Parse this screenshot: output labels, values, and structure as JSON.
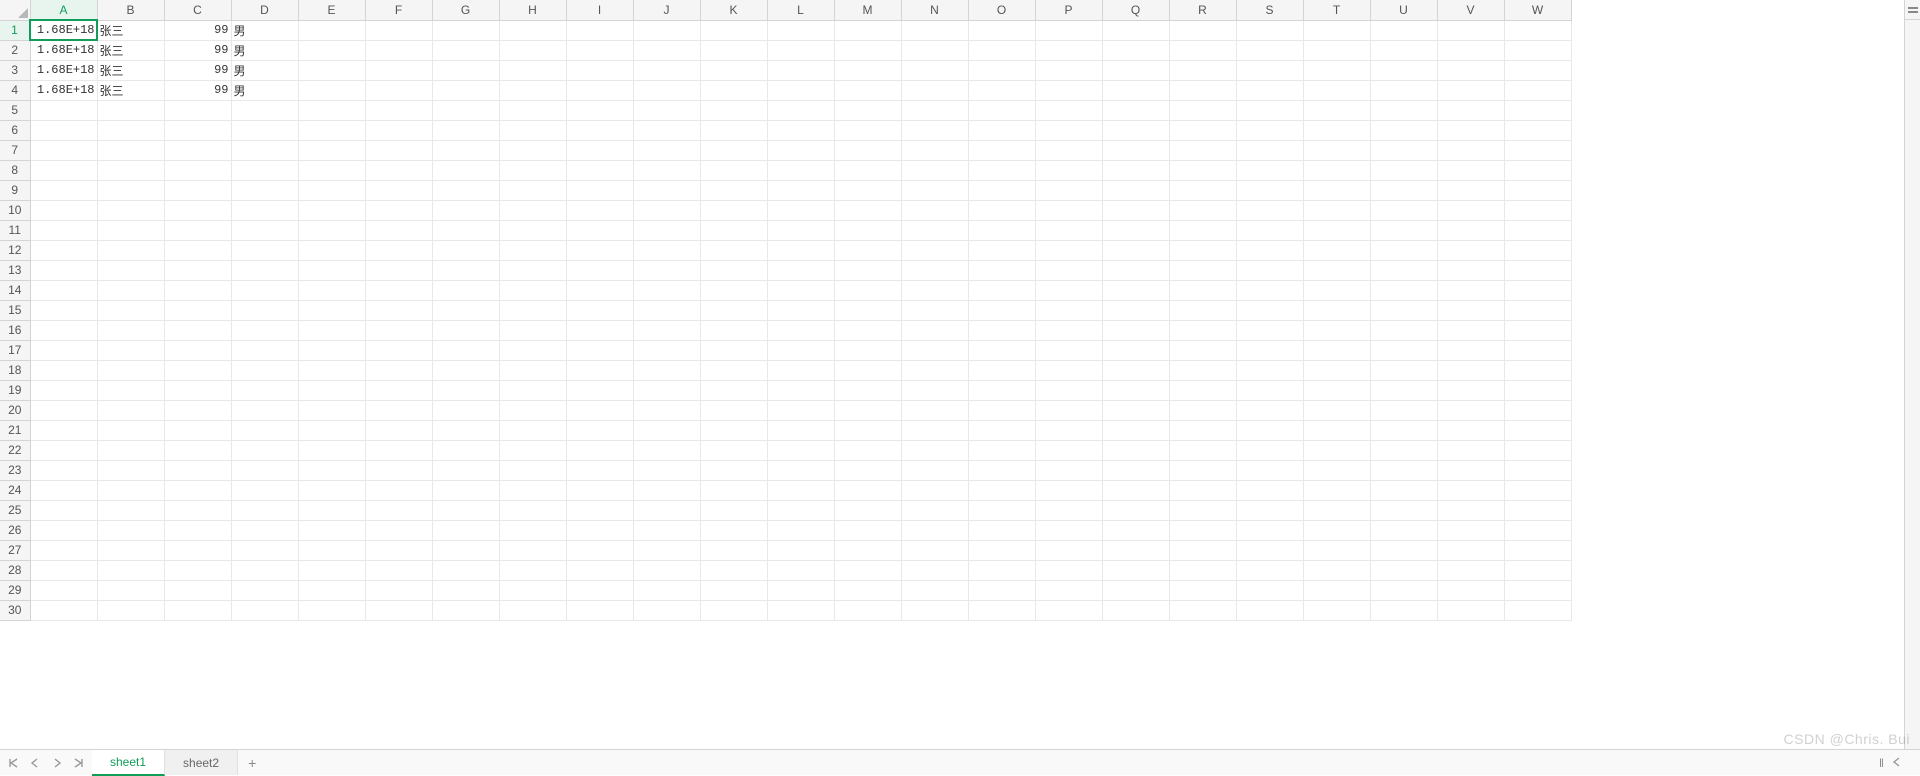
{
  "columns": [
    "A",
    "B",
    "C",
    "D",
    "E",
    "F",
    "G",
    "H",
    "I",
    "J",
    "K",
    "L",
    "M",
    "N",
    "O",
    "P",
    "Q",
    "R",
    "S",
    "T",
    "U",
    "V",
    "W"
  ],
  "row_count": 30,
  "selected_cell": {
    "row": 1,
    "col": "A"
  },
  "data_rows": [
    {
      "A": "1.68E+18",
      "B": "张三",
      "C": "99",
      "D": "男"
    },
    {
      "A": "1.68E+18",
      "B": "张三",
      "C": "99",
      "D": "男"
    },
    {
      "A": "1.68E+18",
      "B": "张三",
      "C": "99",
      "D": "男"
    },
    {
      "A": "1.68E+18",
      "B": "张三",
      "C": "99",
      "D": "男"
    }
  ],
  "col_types": {
    "A": "numeric",
    "B": "text",
    "C": "numeric",
    "D": "text"
  },
  "tabs": [
    {
      "label": "sheet1",
      "active": true
    },
    {
      "label": "sheet2",
      "active": false
    }
  ],
  "add_tab_label": "+",
  "watermark": "CSDN @Chris. Bui"
}
